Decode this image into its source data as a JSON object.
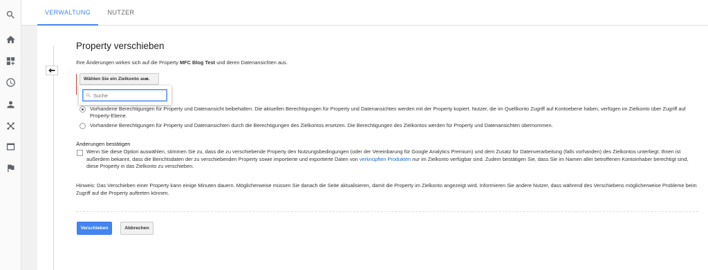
{
  "tabs": [
    {
      "label": "VERWALTUNG",
      "active": true
    },
    {
      "label": "NUTZER",
      "active": false
    }
  ],
  "rail_icons": [
    "search-icon",
    "home-icon",
    "customization-icon",
    "clock-icon",
    "person-icon",
    "acquisition-icon",
    "behavior-icon",
    "flag-icon"
  ],
  "page": {
    "title": "Property verschieben",
    "intro_prefix": "Ihre Änderungen wirken sich auf die Property ",
    "property_name": "MFC Blog Test",
    "intro_suffix": " und deren Datenansichten aus."
  },
  "target_account": {
    "button_label": "Wählen Sie ein Zielkonto aus.",
    "search_placeholder": "Suche",
    "search_value": ""
  },
  "permissions": {
    "options": [
      {
        "checked": true,
        "text": "Vorhandene Berechtigungen für Property und Datenansicht beibehalten. Die aktuellen Berechtigungen für Property und Datenansichten werden mit der Property kopiert. Nutzer, die im Quellkonto Zugriff auf Kontoebene haben, verfügen im Zielkonto über Zugriff auf Property-Ebene."
      },
      {
        "checked": false,
        "text": "Vorhandene Berechtigungen für Property und Datenansichten durch die Berechtigungen des Zielkontos ersetzen. Die Berechtigungen des Zielkontos werden für Property und Datenansichten übernommen."
      }
    ]
  },
  "confirm": {
    "title": "Änderungen bestätigen",
    "checked": false,
    "text_before_link": "Wenn Sie diese Option auswählen, stimmen Sie zu, dass die zu verschiebende Property den Nutzungsbedingungen (oder der Vereinbarung für Google Analytics Premium) und dem Zusatz für Datenverarbeitung (falls vorhanden) des Zielkontos unterliegt. Ihnen ist außerdem bekannt, dass die Berichtsdaten der zu verschiebenden Property sowie importierte und exportierte Daten von ",
    "link_text": "verknüpften Produkten",
    "text_after_link": " nur im Zielkonto verfügbar sind. Zudem bestätigen Sie, dass Sie im Namen aller betroffenen Kontoinhaber berechtigt sind, diese Property in das Zielkonto zu verschieben."
  },
  "hint": "Hinweis: Das Verschieben einer Property kann einige Minuten dauern. Möglicherweise müssen Sie danach die Seite aktualisieren, damit die Property im Zielkonto angezeigt wird. Informieren Sie andere Nutzer, dass während des Verschiebens möglicherweise Probleme beim Zugriff auf die Property auftreten können.",
  "actions": {
    "submit_label": "Verschieben",
    "cancel_label": "Abbrechen"
  },
  "colors": {
    "accent": "#4285f4",
    "error_bar": "#d23f31",
    "link": "#1a66cc"
  }
}
